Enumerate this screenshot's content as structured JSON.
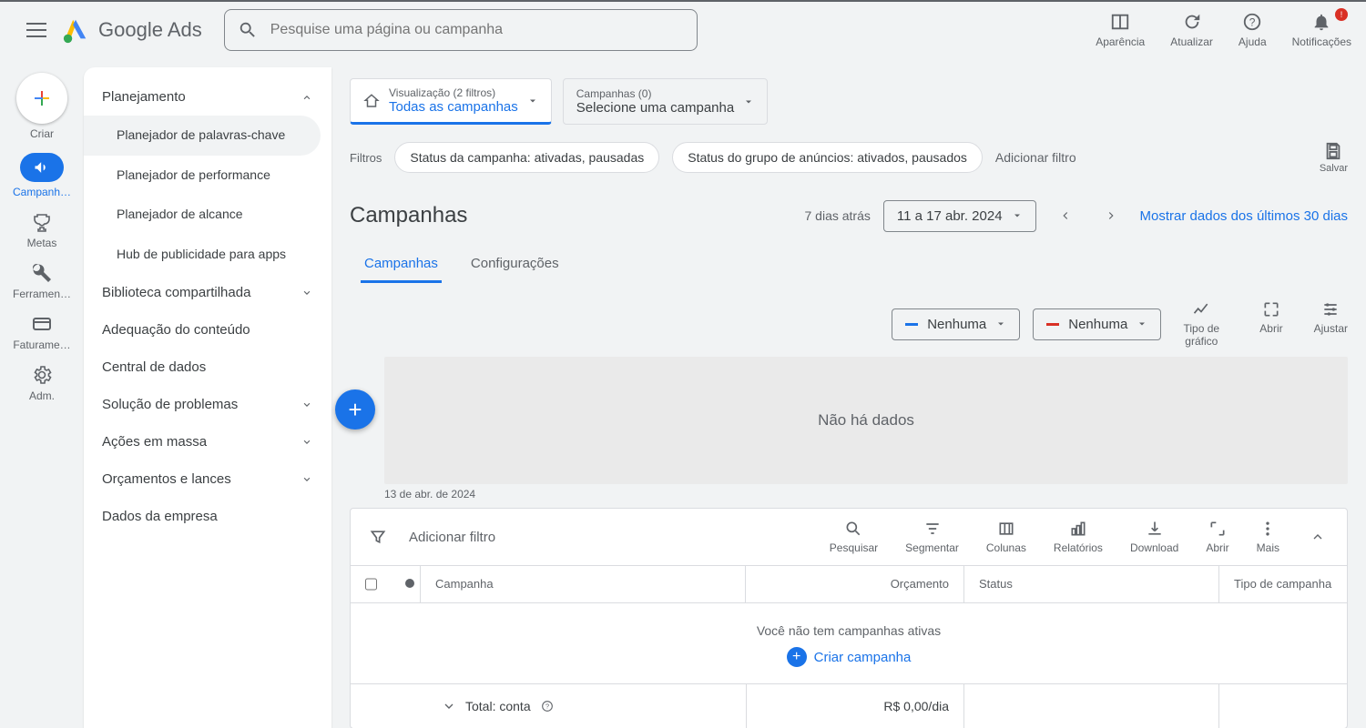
{
  "header": {
    "product_name": "Google Ads",
    "search_placeholder": "Pesquise uma página ou campanha",
    "actions": {
      "appearance": "Aparência",
      "refresh": "Atualizar",
      "help": "Ajuda",
      "notifications": "Notificações",
      "notification_badge": "!"
    }
  },
  "rail": {
    "create": "Criar",
    "campaigns": "Campanh…",
    "goals": "Metas",
    "tools": "Ferramen…",
    "billing": "Faturame…",
    "admin": "Adm."
  },
  "side_panel": {
    "planning": "Planejamento",
    "keyword_planner": "Planejador de palavras-chave",
    "performance_planner": "Planejador de performance",
    "reach_planner": "Planejador de alcance",
    "app_hub": "Hub de publicidade para apps",
    "shared_library": "Biblioteca compartilhada",
    "content_suitability": "Adequação do conteúdo",
    "data_manager": "Central de dados",
    "troubleshooting": "Solução de problemas",
    "bulk_actions": "Ações em massa",
    "budgets_bidding": "Orçamentos e lances",
    "business_data": "Dados da empresa"
  },
  "scope": {
    "view_sub": "Visualização (2 filtros)",
    "view_main": "Todas as campanhas",
    "camp_sub": "Campanhas (0)",
    "camp_main": "Selecione uma campanha"
  },
  "filters": {
    "label": "Filtros",
    "chip_campaign_status": "Status da campanha: ativadas, pausadas",
    "chip_adgroup_status": "Status do grupo de anúncios: ativados, pausados",
    "add_filter": "Adicionar filtro",
    "save": "Salvar"
  },
  "heading": {
    "title": "Campanhas",
    "ago": "7 dias atrás",
    "date_range": "11 a 17 abr. 2024",
    "show_30": "Mostrar dados dos últimos 30 dias"
  },
  "tabs": {
    "campaigns": "Campanhas",
    "settings": "Configurações"
  },
  "chart": {
    "metric_blue": "Nenhuma",
    "metric_red": "Nenhuma",
    "ctrl_chart_type": "Tipo de gráfico",
    "ctrl_expand": "Abrir",
    "ctrl_adjust": "Ajustar",
    "no_data": "Não há dados",
    "axis_date": "13 de abr. de 2024"
  },
  "table": {
    "add_filter": "Adicionar filtro",
    "tool_search": "Pesquisar",
    "tool_segment": "Segmentar",
    "tool_columns": "Colunas",
    "tool_reports": "Relatórios",
    "tool_download": "Download",
    "tool_open": "Abrir",
    "tool_more": "Mais",
    "col_campaign": "Campanha",
    "col_budget": "Orçamento",
    "col_status": "Status",
    "col_type": "Tipo de campanha",
    "empty_text": "Você não tem campanhas ativas",
    "create_campaign": "Criar campanha",
    "total_label": "Total: conta",
    "total_budget": "R$ 0,00/dia"
  }
}
